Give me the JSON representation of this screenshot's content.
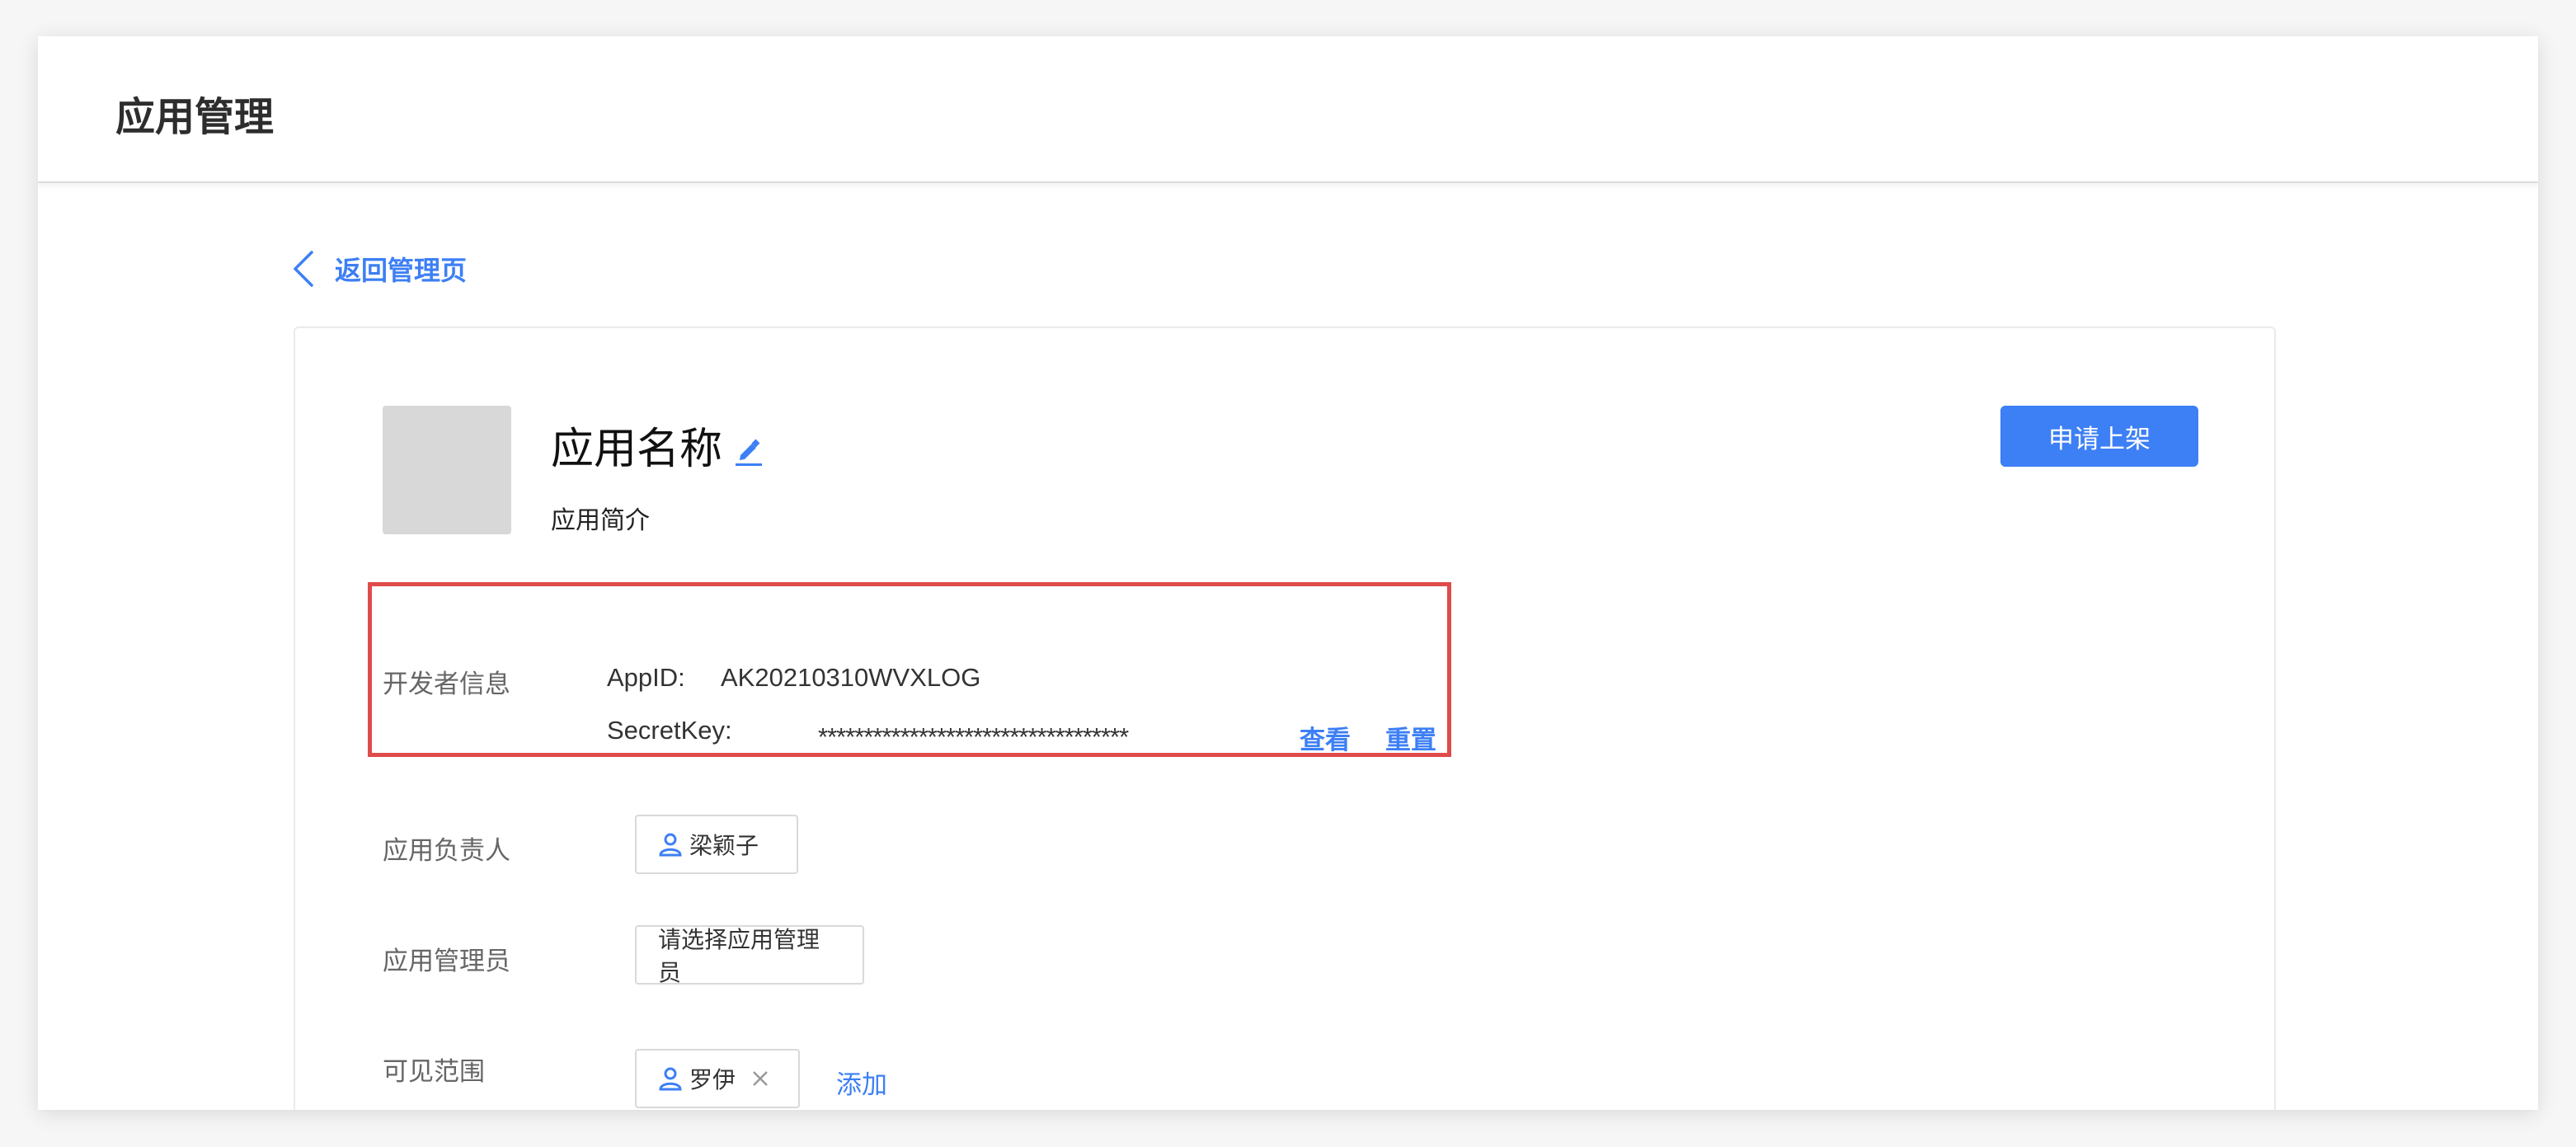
{
  "header": {
    "title": "应用管理"
  },
  "back_link": {
    "label": "返回管理页"
  },
  "app": {
    "name": "应用名称",
    "description": "应用简介",
    "submit_label": "申请上架"
  },
  "developer_info": {
    "label": "开发者信息",
    "appid_label": "AppID:",
    "appid_value": "AK20210310WVXLOG",
    "secret_label": "SecretKey:",
    "secret_value": "**********************************",
    "view_label": "查看",
    "reset_label": "重置"
  },
  "owner": {
    "label": "应用负责人",
    "name": "梁颖子"
  },
  "admin": {
    "label": "应用管理员",
    "placeholder": "请选择应用管理员"
  },
  "visibility": {
    "label": "可见范围",
    "member": "罗伊",
    "add_label": "添加"
  },
  "colors": {
    "accent": "#3d7ff5",
    "highlight": "#e04b4b"
  }
}
